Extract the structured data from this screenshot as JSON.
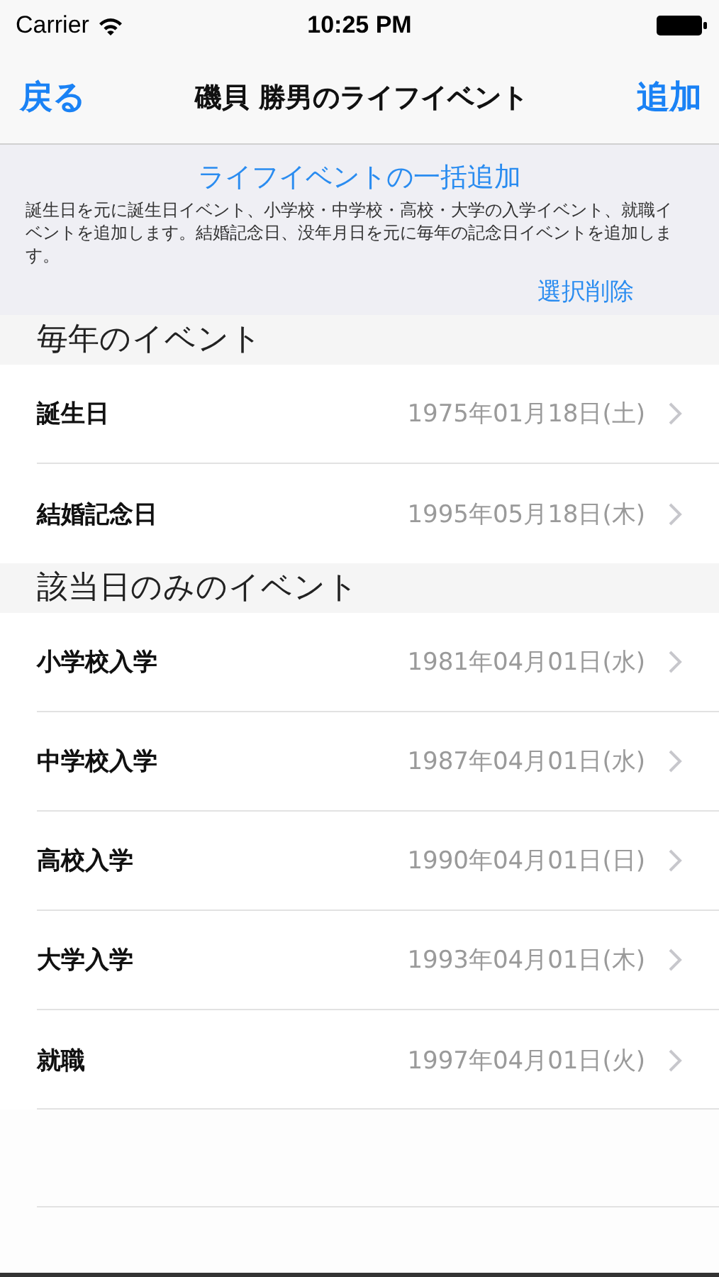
{
  "status_bar": {
    "carrier": "Carrier",
    "time": "10:25 PM"
  },
  "nav": {
    "back": "戻る",
    "title": "磯貝 勝男のライフイベント",
    "add": "追加"
  },
  "bulk_add": {
    "title": "ライフイベントの一括追加",
    "description": "誕生日を元に誕生日イベント、小学校・中学校・高校・大学の入学イベント、就職イベントを追加します。結婚記念日、没年月日を元に毎年の記念日イベントを追加します。",
    "delete": "選択削除"
  },
  "sections": [
    {
      "header": "毎年のイベント",
      "rows": [
        {
          "label": "誕生日",
          "date": "1975年01月18日(土)"
        },
        {
          "label": "結婚記念日",
          "date": "1995年05月18日(木)"
        }
      ]
    },
    {
      "header": "該当日のみのイベント",
      "rows": [
        {
          "label": "小学校入学",
          "date": "1981年04月01日(水)"
        },
        {
          "label": "中学校入学",
          "date": "1987年04月01日(水)"
        },
        {
          "label": "高校入学",
          "date": "1990年04月01日(日)"
        },
        {
          "label": "大学入学",
          "date": "1993年04月01日(木)"
        },
        {
          "label": "就職",
          "date": "1997年04月01日(火)"
        }
      ]
    }
  ]
}
